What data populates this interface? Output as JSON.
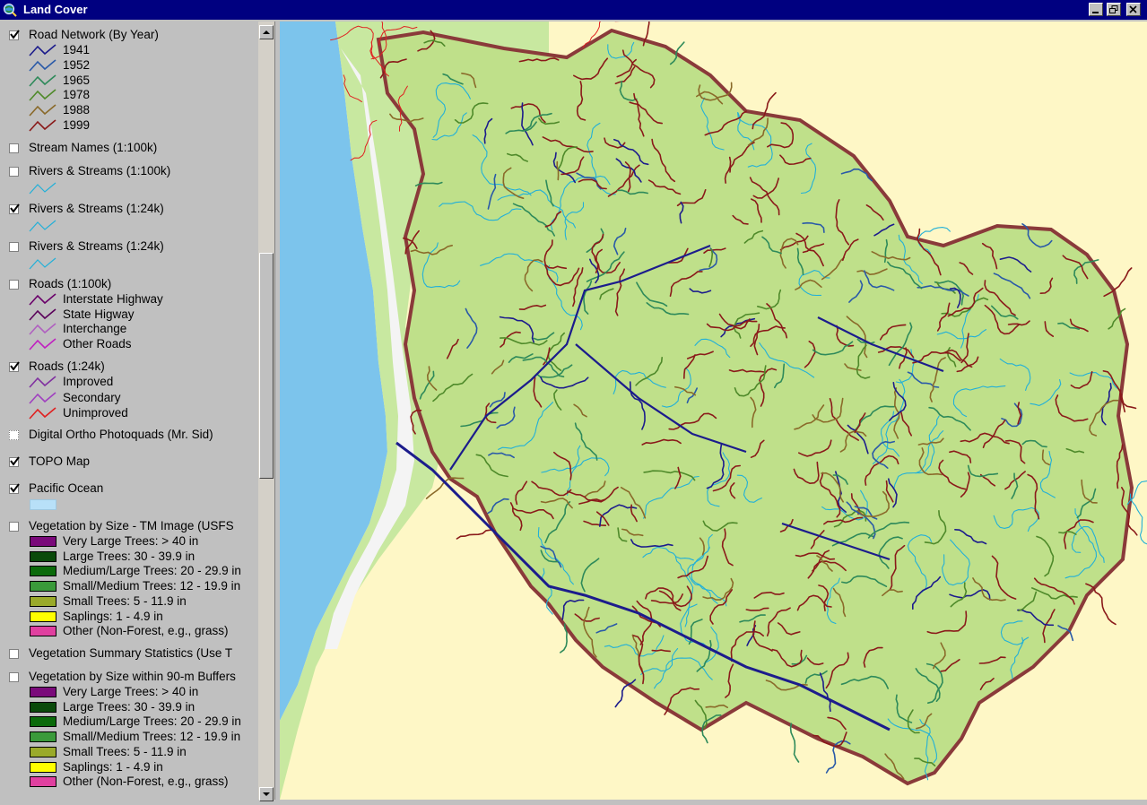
{
  "window": {
    "title": "Land Cover"
  },
  "legend": {
    "road_network": {
      "label": "Road Network (By Year)",
      "checked": true,
      "items": [
        {
          "label": "1941",
          "color": "#1c1c8c"
        },
        {
          "label": "1952",
          "color": "#2a5aa8"
        },
        {
          "label": "1965",
          "color": "#2e8a5a"
        },
        {
          "label": "1978",
          "color": "#4f8a2a"
        },
        {
          "label": "1988",
          "color": "#8a6a2a"
        },
        {
          "label": "1999",
          "color": "#8a1a1a"
        }
      ]
    },
    "stream_names": {
      "label": "Stream Names (1:100k)",
      "checked": false
    },
    "rivers_100k": {
      "label": "Rivers & Streams (1:100k)",
      "checked": false,
      "color": "#22b0d8"
    },
    "rivers_24k_a": {
      "label": "Rivers & Streams (1:24k)",
      "checked": true,
      "color": "#22b0d8"
    },
    "rivers_24k_b": {
      "label": "Rivers & Streams (1:24k)",
      "checked": false,
      "color": "#22b0d8"
    },
    "roads_100k": {
      "label": "Roads (1:100k)",
      "checked": false,
      "items": [
        {
          "label": "Interstate Highway",
          "color": "#6a006a"
        },
        {
          "label": "State Higway",
          "color": "#5a005a"
        },
        {
          "label": "Interchange",
          "color": "#b060c0"
        },
        {
          "label": "Other Roads",
          "color": "#c020c0"
        }
      ]
    },
    "roads_24k": {
      "label": "Roads (1:24k)",
      "checked": true,
      "items": [
        {
          "label": "Improved",
          "color": "#8030a0"
        },
        {
          "label": "Secondary",
          "color": "#a040c0"
        },
        {
          "label": "Unimproved",
          "color": "#e02020"
        }
      ]
    },
    "doq": {
      "label": "Digital Ortho Photoquads (Mr. Sid)",
      "checked": false
    },
    "topo": {
      "label": "TOPO Map",
      "checked": true
    },
    "ocean": {
      "label": "Pacific Ocean",
      "checked": true,
      "color": "#b8e0f8"
    },
    "veg_size": {
      "label": "Vegetation by Size - TM Image (USFS",
      "checked": false,
      "items": [
        {
          "label": "Very Large Trees: > 40  in",
          "color": "#7a0a7a"
        },
        {
          "label": "Large Trees: 30 - 39.9 in",
          "color": "#0a4a0a"
        },
        {
          "label": "Medium/Large Trees: 20 - 29.9 in",
          "color": "#0a6a0a"
        },
        {
          "label": "Small/Medium Trees: 12 - 19.9 in",
          "color": "#3a9a3a"
        },
        {
          "label": "Small Trees: 5 - 11.9 in",
          "color": "#9aaa2a"
        },
        {
          "label": "Saplings: 1 - 4.9 in",
          "color": "#ffff00"
        },
        {
          "label": "Other (Non-Forest, e.g., grass)",
          "color": "#e040a0"
        }
      ]
    },
    "veg_summary": {
      "label": "Vegetation Summary Statistics (Use T",
      "checked": false
    },
    "veg_buffers": {
      "label": "Vegetation by Size within 90-m Buffers",
      "checked": false,
      "items": [
        {
          "label": "Very Large Trees: > 40  in",
          "color": "#7a0a7a"
        },
        {
          "label": "Large Trees: 30 - 39.9 in",
          "color": "#0a4a0a"
        },
        {
          "label": "Medium/Large Trees: 20 - 29.9 in",
          "color": "#0a6a0a"
        },
        {
          "label": "Small/Medium Trees: 12 - 19.9 in",
          "color": "#3a9a3a"
        },
        {
          "label": "Small Trees: 5 - 11.9 in",
          "color": "#9aaa2a"
        },
        {
          "label": "Saplings: 1 - 4.9 in",
          "color": "#ffff00"
        },
        {
          "label": "Other (Non-Forest, e.g., grass)",
          "color": "#e040a0"
        }
      ]
    }
  },
  "map": {
    "background_color": "#fef7c6",
    "ocean_color": "#7cc4ec",
    "land_color": "#c8e8a0",
    "watershed_color": "#bfe08a",
    "boundary_color": "#8a3a3a"
  }
}
